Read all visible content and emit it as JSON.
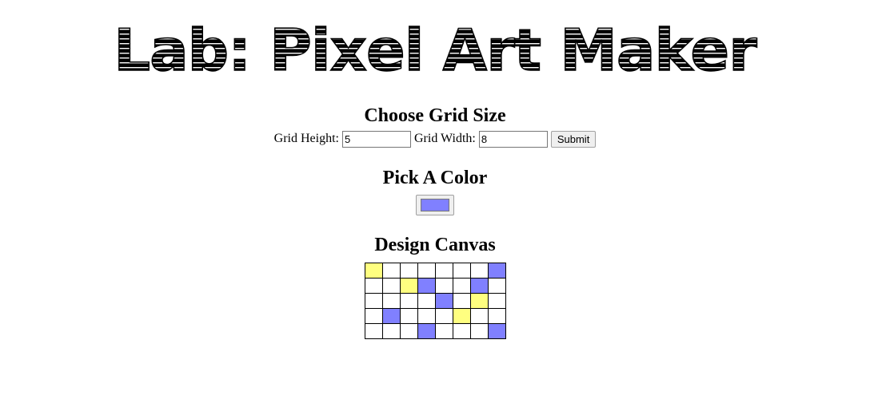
{
  "header": {
    "title": "Lab: Pixel Art Maker"
  },
  "grid_size": {
    "heading": "Choose Grid Size",
    "height_label": "Grid Height:",
    "height_value": "5",
    "width_label": "Grid Width:",
    "width_value": "8",
    "submit_label": "Submit"
  },
  "color": {
    "heading": "Pick A Color",
    "selected": "#8080ff"
  },
  "canvas": {
    "heading": "Design Canvas",
    "colors": {
      "Y": "#ffff80",
      "B": "#8080ff",
      "W": "#ffffff"
    },
    "rows": [
      [
        "Y",
        "W",
        "W",
        "W",
        "W",
        "W",
        "W",
        "B"
      ],
      [
        "W",
        "W",
        "Y",
        "B",
        "W",
        "W",
        "B",
        "W"
      ],
      [
        "W",
        "W",
        "W",
        "W",
        "B",
        "W",
        "Y",
        "W"
      ],
      [
        "W",
        "B",
        "W",
        "W",
        "W",
        "Y",
        "W",
        "W"
      ],
      [
        "W",
        "W",
        "W",
        "B",
        "W",
        "W",
        "W",
        "B"
      ]
    ]
  }
}
